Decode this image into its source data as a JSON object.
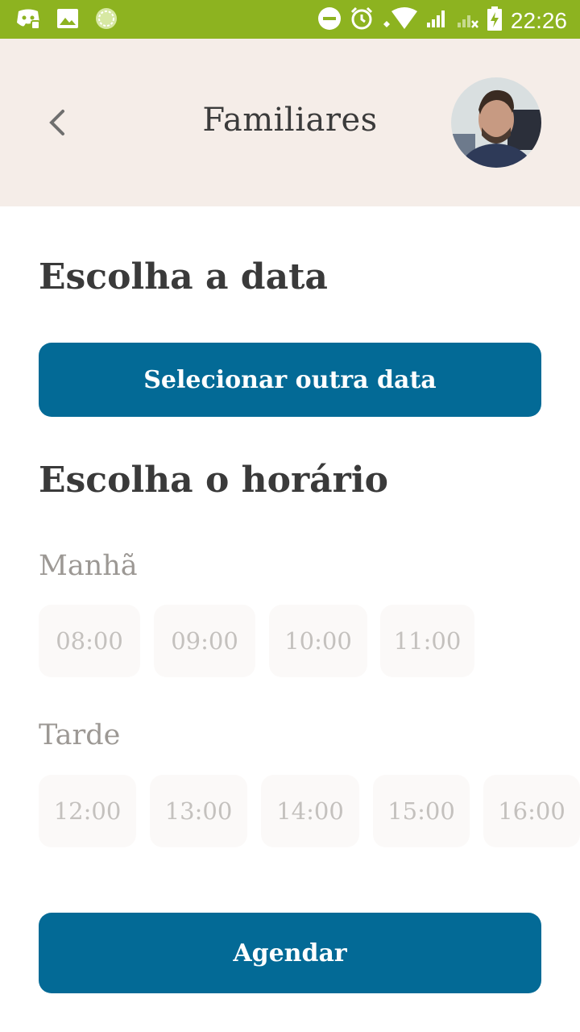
{
  "status_bar": {
    "time": "22:26",
    "left_icons": [
      "discord-icon",
      "gallery-icon",
      "app-icon"
    ],
    "right_icons": [
      "dnd-icon",
      "alarm-icon",
      "wifi-icon",
      "signal-icon",
      "signal-off-icon",
      "battery-charging-icon"
    ],
    "background": "#8db320"
  },
  "header": {
    "title": "Familiares",
    "background": "#f5ede8"
  },
  "date_section": {
    "heading": "Escolha a data",
    "button_label": "Selecionar outra data"
  },
  "time_section": {
    "heading": "Escolha o horário",
    "morning": {
      "label": "Manhã",
      "slots": [
        "08:00",
        "09:00",
        "10:00",
        "11:00"
      ]
    },
    "afternoon": {
      "label": "Tarde",
      "slots": [
        "12:00",
        "13:00",
        "14:00",
        "15:00",
        "16:00"
      ]
    }
  },
  "submit_label": "Agendar",
  "colors": {
    "primary": "#036a96",
    "slot_bg": "#fbf9f8",
    "slot_text": "#c4c1be"
  }
}
